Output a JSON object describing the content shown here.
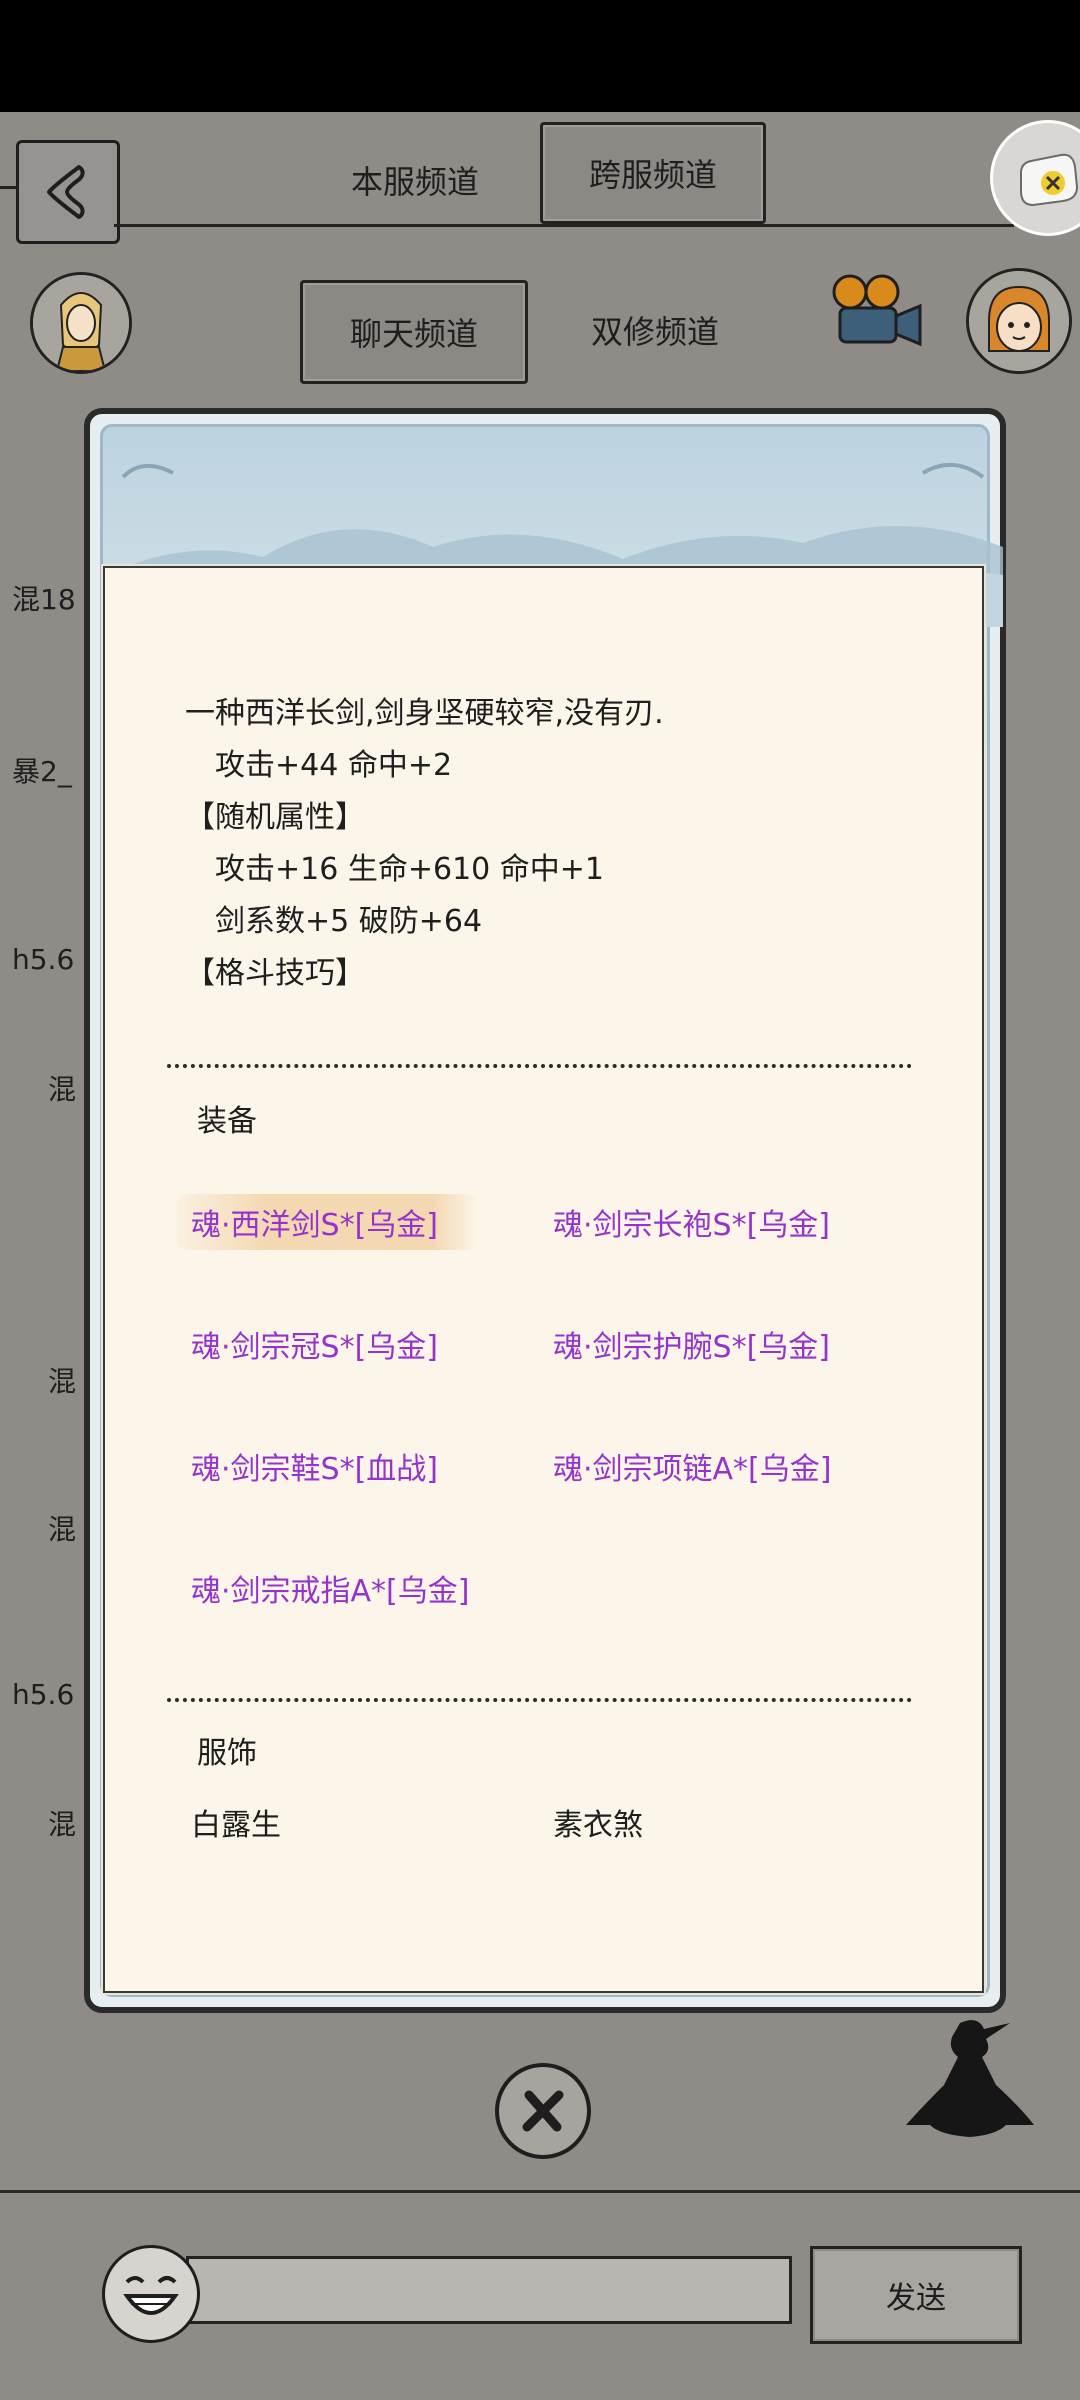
{
  "header": {
    "tabs_top": [
      {
        "label": "本服频道",
        "active": false
      },
      {
        "label": "跨服频道",
        "active": true
      }
    ],
    "tabs_second": [
      {
        "label": "聊天频道",
        "active": true
      },
      {
        "label": "双修频道",
        "active": false
      }
    ]
  },
  "side_labels": [
    "混18",
    "暴2_",
    "h5.6",
    "混",
    "混",
    "混",
    "h5.6",
    "混"
  ],
  "item": {
    "description": "一种西洋长剑,剑身坚硬较窄,没有刃.",
    "base_stats": "攻击+44 命中+2",
    "random_attr_title": "【随机属性】",
    "random_attr_line1": "攻击+16 生命+610 命中+1",
    "random_attr_line2": "剑系数+5 破防+64",
    "skill_title": "【格斗技巧】"
  },
  "equipment": {
    "title": "装备",
    "items": [
      "魂·西洋剑S*[乌金]",
      "魂·剑宗长袍S*[乌金]",
      "魂·剑宗冠S*[乌金]",
      "魂·剑宗护腕S*[乌金]",
      "魂·剑宗鞋S*[血战]",
      "魂·剑宗项链A*[乌金]",
      "魂·剑宗戒指A*[乌金]"
    ]
  },
  "costume": {
    "title": "服饰",
    "items": [
      "白露生",
      "素衣煞"
    ]
  },
  "chat": {
    "input_value": "",
    "send_label": "发送"
  },
  "colors": {
    "equip_purple": "#9633cc",
    "panel_bg": "#fbf6e9",
    "page_bg": "#8f8c87"
  }
}
